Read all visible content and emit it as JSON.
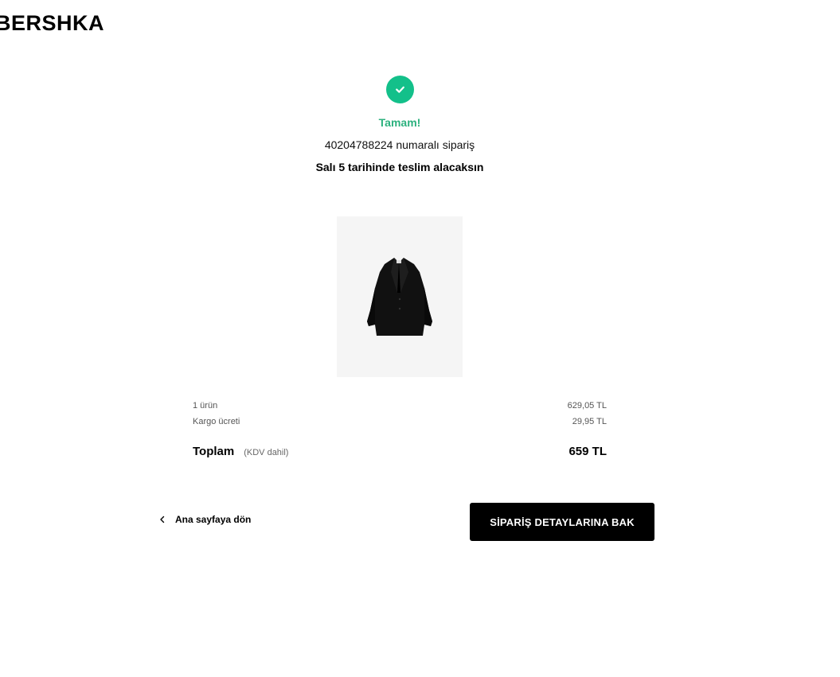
{
  "header": {
    "logo_text": "BERSHKA"
  },
  "confirmation": {
    "status_title": "Tamam!",
    "order_text": "40204788224 numaralı sipariş",
    "delivery_text": "Salı 5 tarihinde teslim alacaksın",
    "status_color": "#13c08a"
  },
  "product": {
    "image_icon": "black-blazer-image"
  },
  "summary": {
    "items_label": "1 ürün",
    "items_value": "629,05 TL",
    "shipping_label": "Kargo ücreti",
    "shipping_value": "29,95 TL",
    "total_label": "Toplam",
    "total_note": "(KDV dahil)",
    "total_value": "659 TL"
  },
  "actions": {
    "back_label": "Ana sayfaya dön",
    "details_label": "SİPARİŞ DETAYLARINA BAK"
  }
}
